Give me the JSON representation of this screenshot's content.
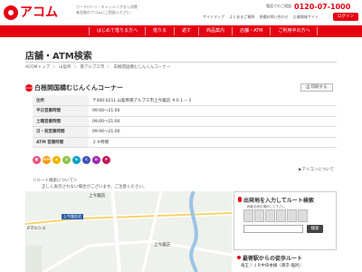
{
  "header": {
    "logo_text": "アコム",
    "tagline": "カードローン・キャッシングなら消費者金融のアコムにご相談ください",
    "phone_label": "電話でのご相談",
    "phone": "0120-07-1000",
    "links": [
      "サイトマップ",
      "よくあるご質問",
      "各種お問い合わせ",
      "企業情報サイト"
    ],
    "login": "ログイン"
  },
  "nav": {
    "items": [
      "はじめて借りる方へ",
      "借りる",
      "返す",
      "商品案内",
      "店舗・ATM",
      "ご利用中の方へ"
    ]
  },
  "page": {
    "title": "店舗・ATM検索",
    "breadcrumb": [
      "ACOMトップ",
      "山梨県",
      "南アルプス市",
      "白根開国橋むじんくんコーナー"
    ]
  },
  "store": {
    "badge": "ACOM",
    "name": "白根開国橋むじんくんコーナー",
    "print": "印刷する",
    "rows": [
      {
        "label": "住所",
        "value": "〒400-0211 山梨県南アルプス市上今諏訪 ４６１－３"
      },
      {
        "label": "平日営業時間",
        "value": "09:00～21:00"
      },
      {
        "label": "土曜営業時間",
        "value": "09:00～21:00"
      },
      {
        "label": "日・祝営業時間",
        "value": "09:00～21:00"
      },
      {
        "label": "ATM 営業時間",
        "value": "２４時間"
      }
    ],
    "services": [
      {
        "label": "新",
        "color": "#e94f7a"
      },
      {
        "label": "ATM",
        "color": "#f39800"
      },
      {
        "label": "A",
        "color": "#f5b300"
      },
      {
        "label": "カ",
        "color": "#8bc34a"
      },
      {
        "label": "B",
        "color": "#00a0c6"
      },
      {
        "label": "C",
        "color": "#3f51b5"
      },
      {
        "label": "D",
        "color": "#9c27b0"
      },
      {
        "label": "P",
        "color": "#c2185b"
      }
    ],
    "icon_note": "▶アイコンについて"
  },
  "route_notes": {
    "line1": "＜ルート検索について＞",
    "line2": "正しく表示されない場合がございます。ご注意ください。"
  },
  "map": {
    "labels": {
      "top": "上今諏訪",
      "station": "上今諏訪北",
      "left": "ifマルシェ",
      "right": "上今諏訪"
    }
  },
  "route": {
    "title": "出発地を入力してルート検索",
    "desc": "移動手段を選択して下さい",
    "search": "検索"
  },
  "nearby": {
    "title": "最寄駅からの徒歩ルート",
    "item": "竜王 / ＪＲ中央本線（東京-塩尻）"
  }
}
